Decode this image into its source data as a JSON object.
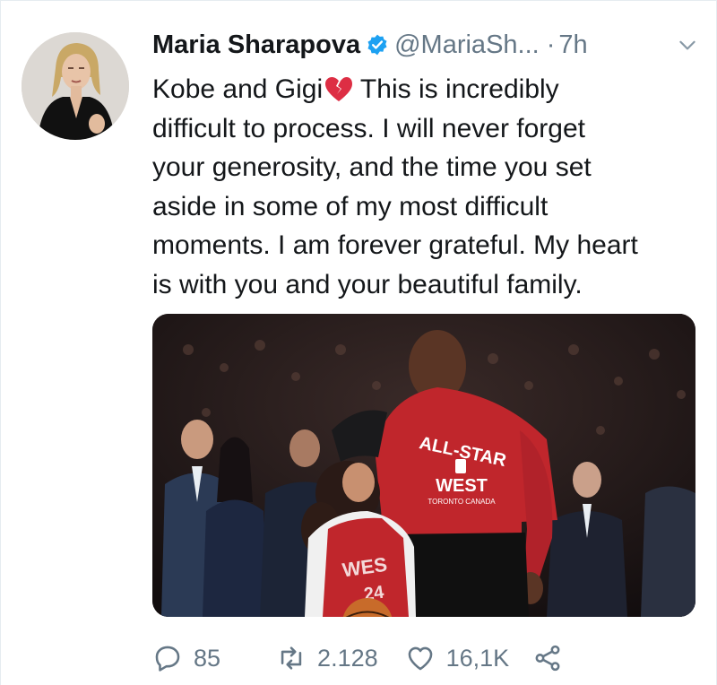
{
  "tweet": {
    "author_name": "Maria Sharapova",
    "handle": "@MariaSh...",
    "separator": "·",
    "time": "7h",
    "text_line1_before": "Kobe and Gigi",
    "text_line1_after": " This is incredibly",
    "text_line2": "difficult to process. I will never forget",
    "text_line3": "your generosity, and the time you set",
    "text_line4": "aside in some of my most difficult",
    "text_line5": "moments. I am forever grateful. My heart",
    "text_line6": "is with you and your beautiful family.",
    "emoji": "broken-heart-icon"
  },
  "media": {
    "shirt_adult_line1": "ALL-STAR",
    "shirt_adult_line2": "WEST",
    "shirt_adult_line3": "TORONTO CANADA",
    "shirt_child_text": "WES",
    "shirt_child_number": "24"
  },
  "actions": {
    "reply_count": "85",
    "retweet_count": "2.128",
    "like_count": "16,1K"
  },
  "colors": {
    "verified_badge": "#1da1f2",
    "secondary_text": "#657786",
    "jersey_red": "#c0262c"
  },
  "icons": [
    "verified-badge-icon",
    "chevron-down-icon",
    "broken-heart-icon",
    "reply-icon",
    "retweet-icon",
    "like-icon",
    "share-icon"
  ]
}
